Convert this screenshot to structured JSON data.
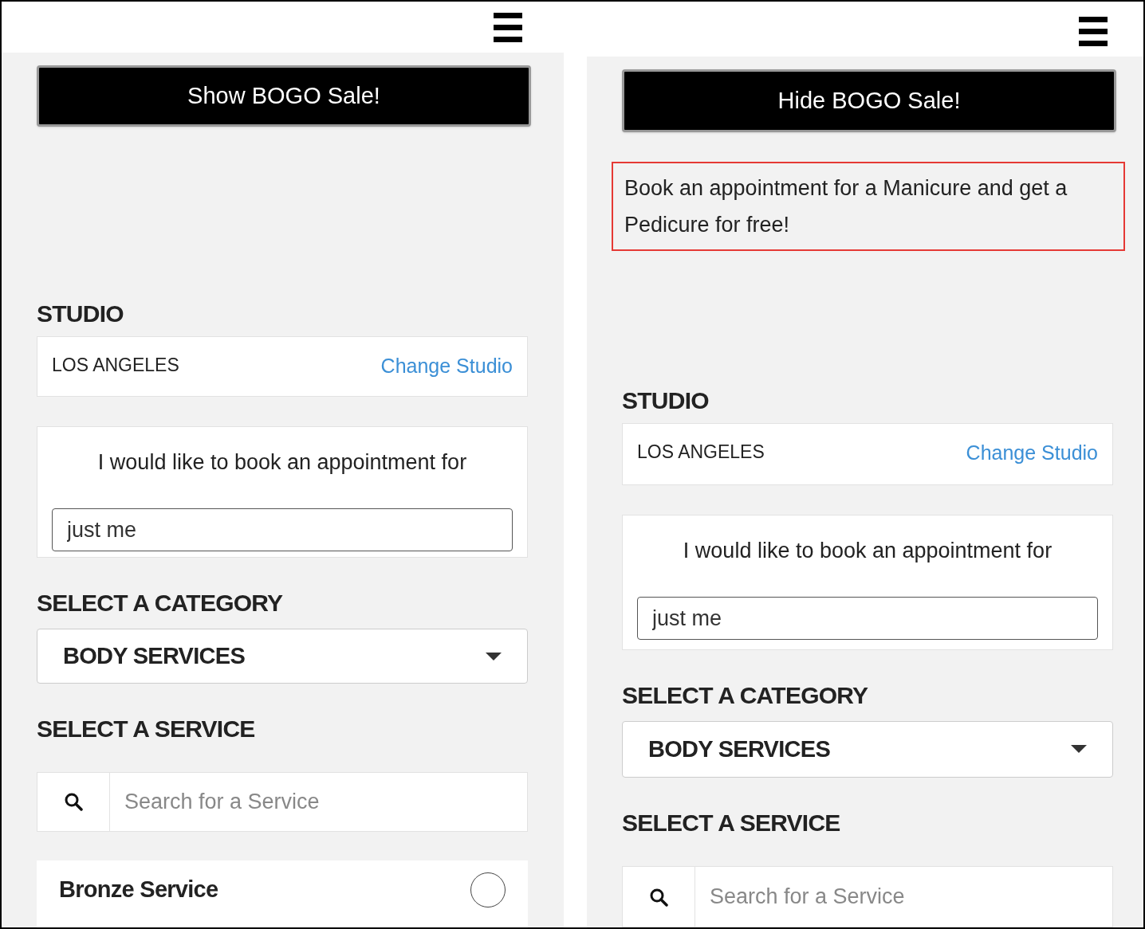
{
  "screens": [
    {
      "bogo_button": "Show BOGO Sale!",
      "studio_heading": "STUDIO",
      "studio_name": "LOS ANGELES",
      "change_link": "Change Studio",
      "appointment_prompt": "I would like to book an appointment for",
      "party_value": "just me",
      "category_heading": "SELECT A CATEGORY",
      "category_value": "BODY SERVICES",
      "service_heading": "SELECT A SERVICE",
      "search_placeholder": "Search for a Service",
      "services": [
        {
          "name": "Bronze Service",
          "selected": false
        }
      ]
    },
    {
      "bogo_button": "Hide BOGO Sale!",
      "promo": {
        "text": "Book an appointment for a Manicure and get a Pedicure for free!",
        "highlighted": true
      },
      "studio_heading": "STUDIO",
      "studio_name": "LOS ANGELES",
      "change_link": "Change Studio",
      "appointment_prompt": "I would like to book an appointment for",
      "party_value": "just me",
      "category_heading": "SELECT A CATEGORY",
      "category_value": "BODY SERVICES",
      "service_heading": "SELECT A SERVICE",
      "search_placeholder": "Search for a Service"
    }
  ]
}
